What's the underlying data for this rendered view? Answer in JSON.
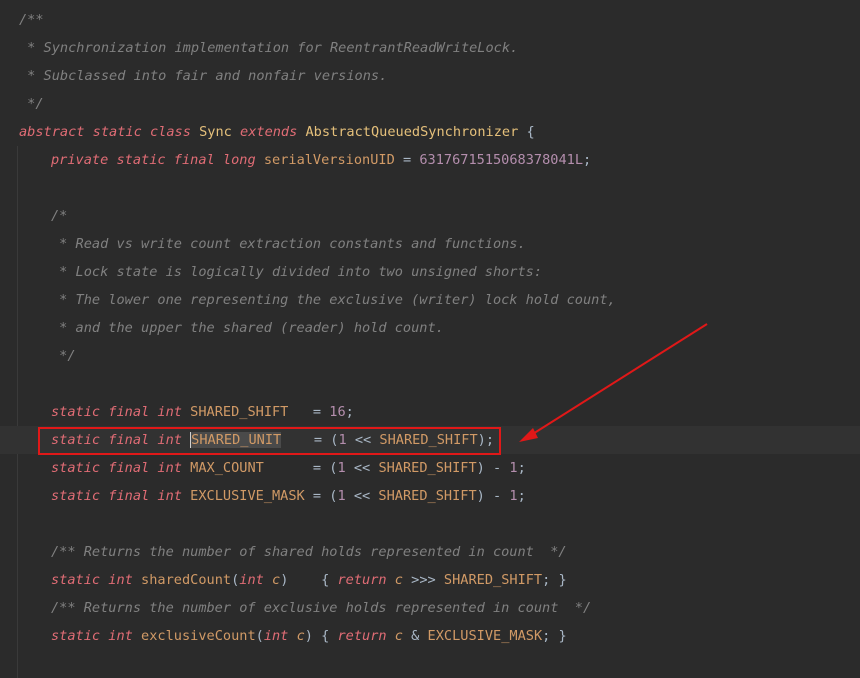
{
  "code": {
    "lines": [
      [
        "/**"
      ],
      [
        " * Synchronization implementation for ReentrantReadWriteLock."
      ],
      [
        " * Subclassed into fair and nonfair versions."
      ],
      [
        " */"
      ],
      [
        "abstract",
        " ",
        "static",
        " ",
        "class",
        " ",
        "Sync",
        " ",
        "extends",
        " ",
        "AbstractQueuedSynchronizer",
        " {"
      ],
      [
        "private",
        " ",
        "static",
        " ",
        "final",
        " ",
        "long",
        " ",
        "serialVersionUID",
        " = ",
        "6317671515068378041L",
        ";"
      ],
      [
        ""
      ],
      [
        "/*"
      ],
      [
        " * Read vs write count extraction constants and functions."
      ],
      [
        " * Lock state is logically divided into two unsigned shorts:"
      ],
      [
        " * The lower one representing the exclusive (writer) lock hold count,"
      ],
      [
        " * and the upper the shared (reader) hold count."
      ],
      [
        " */"
      ],
      [
        ""
      ],
      [
        "static",
        " ",
        "final",
        " ",
        "int",
        " ",
        "SHARED_SHIFT",
        "   = ",
        "16",
        ";"
      ],
      [
        "static",
        " ",
        "final",
        " ",
        "int",
        " ",
        "SHARED_UNIT",
        "    = (",
        "1",
        " << ",
        "SHARED_SHIFT",
        ");"
      ],
      [
        "static",
        " ",
        "final",
        " ",
        "int",
        " ",
        "MAX_COUNT",
        "      = (",
        "1",
        " << ",
        "SHARED_SHIFT",
        ") - ",
        "1",
        ";"
      ],
      [
        "static",
        " ",
        "final",
        " ",
        "int",
        " ",
        "EXCLUSIVE_MASK",
        " = (",
        "1",
        " << ",
        "SHARED_SHIFT",
        ") - ",
        "1",
        ";"
      ],
      [
        ""
      ],
      [
        "/** Returns the number of shared holds represented in count  */"
      ],
      [
        "static",
        " ",
        "int",
        " ",
        "sharedCount",
        "(",
        "int",
        " ",
        "c",
        ")    { ",
        "return",
        " ",
        "c",
        " >>> ",
        "SHARED_SHIFT",
        "; }"
      ],
      [
        "/** Returns the number of exclusive holds represented in count  */"
      ],
      [
        "static",
        " ",
        "int",
        " ",
        "exclusiveCount",
        "(",
        "int",
        " ",
        "c",
        ") { ",
        "return",
        " ",
        "c",
        " & ",
        "EXCLUSIVE_MASK",
        "; }"
      ]
    ]
  },
  "annotation": {
    "box_color": "#e01818",
    "arrow_color": "#e01818"
  },
  "colors": {
    "background": "#2b2b2b",
    "comment": "#808080",
    "keyword": "#e06c75",
    "class_name": "#e5c07b",
    "field": "#d19a66",
    "number": "#b48ead",
    "default": "#a9b7c6"
  },
  "icons": {
    "gutter": "lightbulb-icon"
  }
}
